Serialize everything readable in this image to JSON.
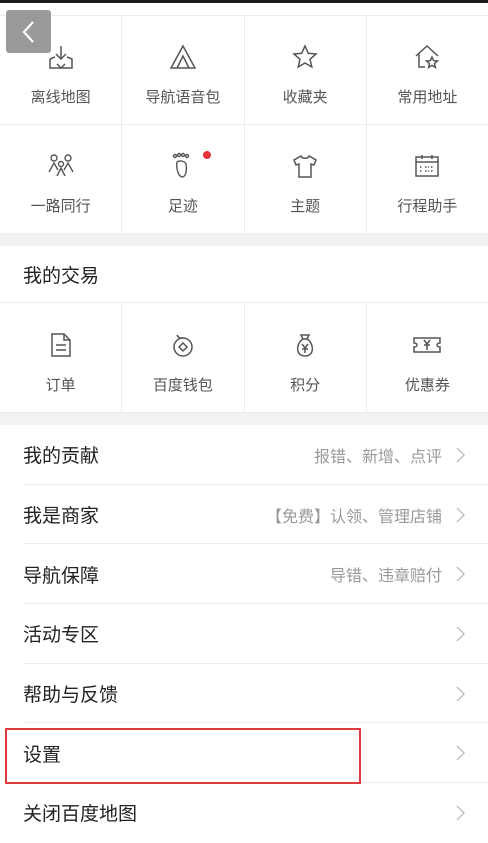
{
  "back_icon": "chevron-left-icon",
  "grid_top": {
    "row1": [
      {
        "label": "离线地图",
        "icon": "download-map-icon"
      },
      {
        "label": "导航语音包",
        "icon": "voice-pack-icon"
      },
      {
        "label": "收藏夹",
        "icon": "star-icon"
      },
      {
        "label": "常用地址",
        "icon": "home-star-icon"
      }
    ],
    "row2": [
      {
        "label": "一路同行",
        "icon": "people-icon"
      },
      {
        "label": "足迹",
        "icon": "footprint-icon",
        "badge_color": "#e8343b"
      },
      {
        "label": "主题",
        "icon": "tshirt-icon"
      },
      {
        "label": "行程助手",
        "icon": "calendar-icon"
      }
    ]
  },
  "trade": {
    "title": "我的交易",
    "items": [
      {
        "label": "订单",
        "icon": "document-icon"
      },
      {
        "label": "百度钱包",
        "icon": "wallet-icon"
      },
      {
        "label": "积分",
        "icon": "money-bag-icon"
      },
      {
        "label": "优惠券",
        "icon": "coupon-icon"
      }
    ]
  },
  "menu": [
    {
      "label": "我的贡献",
      "hint": "报错、新增、点评"
    },
    {
      "label": "我是商家",
      "hint": "【免费】认领、管理店铺"
    },
    {
      "label": "导航保障",
      "hint": "导错、违章赔付"
    },
    {
      "label": "活动专区",
      "hint": ""
    },
    {
      "label": "帮助与反馈",
      "hint": ""
    },
    {
      "label": "设置",
      "hint": "",
      "highlighted": true
    },
    {
      "label": "关闭百度地图",
      "hint": ""
    }
  ],
  "colors": {
    "highlight_border": "#e0393e",
    "badge": "#e8343b",
    "separator": "#f2f2f2"
  }
}
